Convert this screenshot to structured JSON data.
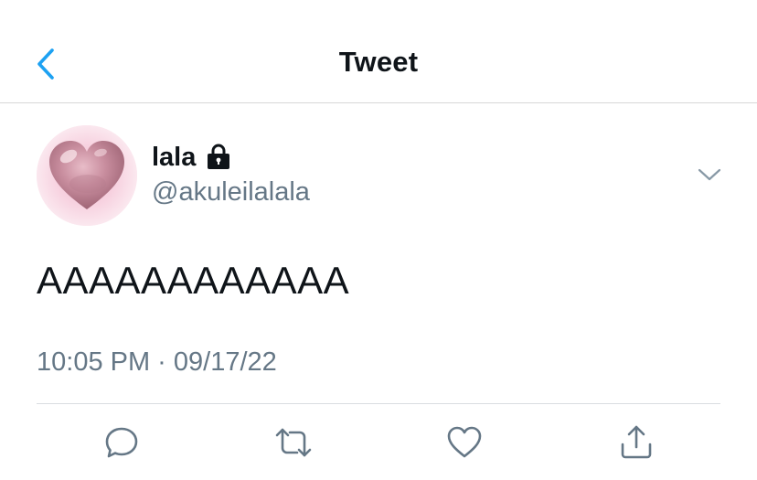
{
  "header": {
    "title": "Tweet",
    "back_icon": "chevron-left-icon"
  },
  "tweet": {
    "author": {
      "display_name": "lala",
      "handle": "@akuleilalala",
      "protected_icon": "lock-icon",
      "avatar": "pink-heart-avatar"
    },
    "text": "AAAAAAAAAAAA",
    "timestamp": "10:05 PM · 09/17/22",
    "menu_icon": "chevron-down-icon"
  },
  "actions": [
    {
      "name": "reply",
      "icon": "reply-icon"
    },
    {
      "name": "retweet",
      "icon": "retweet-icon"
    },
    {
      "name": "like",
      "icon": "heart-icon"
    },
    {
      "name": "share",
      "icon": "share-icon"
    }
  ],
  "colors": {
    "accent": "#1da1f2",
    "text_primary": "#0f1419",
    "text_secondary": "#657786",
    "divider": "#d9dde1"
  }
}
